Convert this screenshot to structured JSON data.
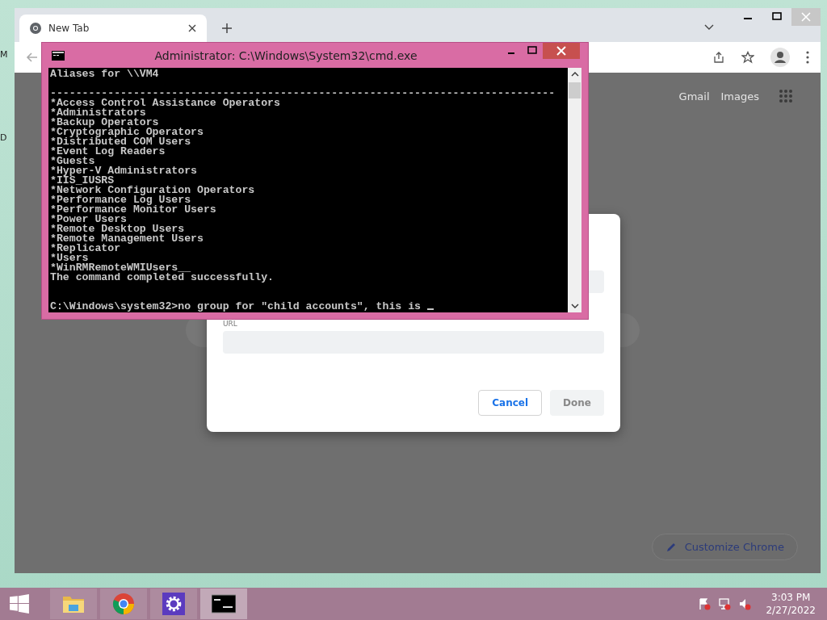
{
  "desktop": {
    "icon_label_fragments": [
      "M",
      "D"
    ]
  },
  "browser": {
    "tab": {
      "title": "New Tab",
      "selected": true
    },
    "links": [
      "Gmail",
      "Images"
    ],
    "customize_button": "Customize Chrome"
  },
  "dialog": {
    "url_label": "URL",
    "cancel": "Cancel",
    "done": {
      "label": "Done",
      "disabled": true
    }
  },
  "cmd": {
    "title": "Administrator: C:\\Windows\\System32\\cmd.exe",
    "lines": [
      {
        "kind": "text",
        "text": "Aliases for \\\\VM4"
      },
      {
        "kind": "blank"
      },
      {
        "kind": "text",
        "text": "-------------------------------------------------------------------------------"
      },
      {
        "kind": "text",
        "text": "*Access Control Assistance Operators"
      },
      {
        "kind": "text",
        "text": "*Administrators"
      },
      {
        "kind": "text",
        "text": "*Backup Operators"
      },
      {
        "kind": "text",
        "text": "*Cryptographic Operators"
      },
      {
        "kind": "text",
        "text": "*Distributed COM Users"
      },
      {
        "kind": "text",
        "text": "*Event Log Readers"
      },
      {
        "kind": "text",
        "text": "*Guests"
      },
      {
        "kind": "text",
        "text": "*Hyper-V Administrators"
      },
      {
        "kind": "text",
        "text": "*IIS_IUSRS"
      },
      {
        "kind": "text",
        "text": "*Network Configuration Operators"
      },
      {
        "kind": "text",
        "text": "*Performance Log Users"
      },
      {
        "kind": "text",
        "text": "*Performance Monitor Users"
      },
      {
        "kind": "text",
        "text": "*Power Users"
      },
      {
        "kind": "text",
        "text": "*Remote Desktop Users"
      },
      {
        "kind": "text",
        "text": "*Remote Management Users"
      },
      {
        "kind": "text",
        "text": "*Replicator"
      },
      {
        "kind": "text",
        "text": "*Users"
      },
      {
        "kind": "text",
        "text": "*WinRMRemoteWMIUsers__"
      },
      {
        "kind": "text",
        "text": "The command completed successfully."
      },
      {
        "kind": "blank"
      },
      {
        "kind": "blank"
      },
      {
        "kind": "prompt",
        "text": "C:\\Windows\\system32>no group for \"child accounts\", this is "
      }
    ]
  },
  "taskbar": {
    "apps": [
      {
        "kind": "explorer",
        "selected": false
      },
      {
        "kind": "chrome",
        "selected": false
      },
      {
        "kind": "settings",
        "selected": false
      },
      {
        "kind": "console",
        "selected": true
      }
    ],
    "clock": {
      "time": "3:03 PM",
      "date": "2/27/2022"
    }
  }
}
